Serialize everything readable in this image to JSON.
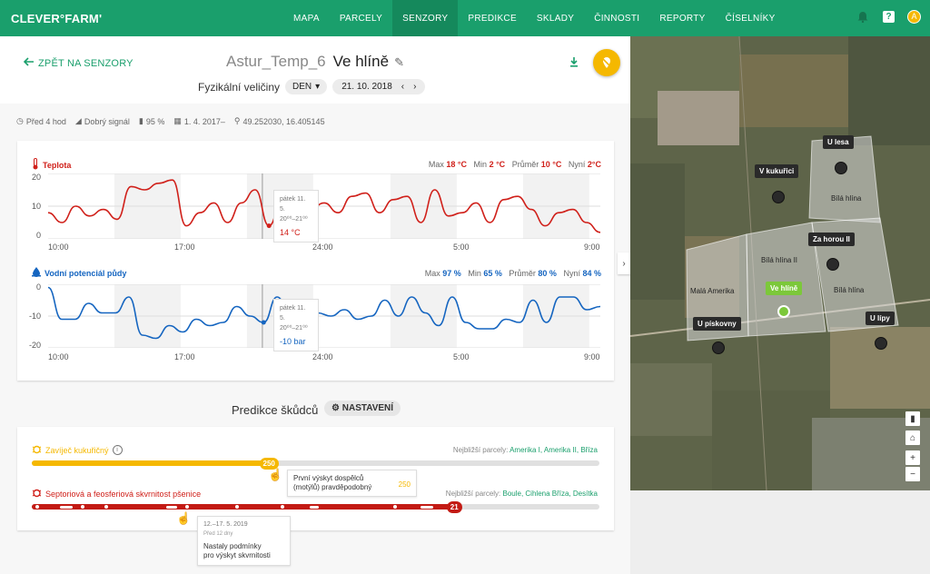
{
  "brand": {
    "logo": "CLEVER°FARM'"
  },
  "nav": {
    "items": [
      "MAPA",
      "PARCELY",
      "SENZORY",
      "PREDIKCE",
      "SKLADY",
      "ČINNOSTI",
      "REPORTY",
      "ČÍSELNÍKY"
    ],
    "active": "SENZORY"
  },
  "topbar": {
    "help": "?",
    "avatar": "A"
  },
  "header": {
    "back": "ZPĚT NA SENZORY",
    "sensor_name": "Astur_Temp_6",
    "location": "Ve hlíně",
    "subtitle": "Fyzikální veličiny",
    "period": "DEN",
    "date": "21. 10. 2018"
  },
  "info": {
    "last_seen": "Před 4 hod",
    "signal": "Dobrý signál",
    "battery": "95 %",
    "since": "1. 4. 2017–",
    "coords": "49.252030, 16.405145"
  },
  "chart_data": [
    {
      "type": "line",
      "title": "Teplota",
      "x_ticks": [
        "10:00",
        "17:00",
        "24:00",
        "5:00",
        "9:00"
      ],
      "y_ticks": [
        "20",
        "10",
        "0"
      ],
      "ylim": [
        0,
        20
      ],
      "stats": {
        "max_label": "Max",
        "max": "18 °C",
        "min_label": "Min",
        "min": "2 °C",
        "avg_label": "Průměr",
        "avg": "10 °C",
        "now_label": "Nyní",
        "now": "2°C"
      },
      "tooltip": {
        "date": "pátek 11. 5.",
        "range": "20⁰⁰–21⁰⁰",
        "value": "14 °C"
      },
      "series": [
        {
          "values": [
            8,
            5,
            10,
            7,
            9,
            6,
            16,
            15,
            17,
            18,
            4,
            8,
            11,
            5,
            11,
            15,
            4,
            13,
            12,
            9,
            11,
            8,
            13,
            14,
            8,
            12,
            13,
            5,
            15,
            7,
            8,
            11,
            5,
            12,
            13,
            9,
            4,
            8,
            9,
            5,
            2
          ]
        }
      ],
      "color": "#d0201a"
    },
    {
      "type": "line",
      "title": "Vodní potenciál půdy",
      "x_ticks": [
        "10:00",
        "17:00",
        "24:00",
        "5:00",
        "9:00"
      ],
      "y_ticks": [
        "0",
        "-10",
        "-20"
      ],
      "ylim": [
        -20,
        0
      ],
      "stats": {
        "max_label": "Max",
        "max": "97 %",
        "min_label": "Min",
        "min": "65 %",
        "avg_label": "Průměr",
        "avg": "80 %",
        "now_label": "Nyní",
        "now": "84 %"
      },
      "tooltip": {
        "date": "pátek 11. 5.",
        "range": "20⁰⁰–21⁰⁰",
        "value": "-10 bar"
      },
      "series": [
        {
          "values": [
            -1,
            -11,
            -11,
            -6,
            -9,
            -9,
            -4,
            -16,
            -17,
            -13,
            -15,
            -11,
            -13,
            -12,
            -7,
            -10,
            -12,
            -4,
            -10,
            -13,
            -9,
            -10,
            -8,
            -11,
            -10,
            -5,
            -10,
            -4,
            -9,
            -13,
            -4,
            -12,
            -14,
            -14,
            -11,
            -12,
            -5,
            -12,
            -4,
            -4,
            -8,
            -7
          ]
        }
      ],
      "color": "#1565c0"
    }
  ],
  "prediction": {
    "title": "Predikce škůdců",
    "settings": "NASTAVENÍ",
    "pests": [
      {
        "name": "Zavíječ kukuřičný",
        "near_label": "Nejbližší parcely:",
        "near": "Amerika I, Amerika II, Bříza",
        "value": "250",
        "progress": 0.42,
        "tip_text1": "První výskyt dospělců",
        "tip_text2": "(motýlů) pravděpodobný",
        "tip_value": "250"
      },
      {
        "name": "Septoriová a feosferiová skvrnitost pšenice",
        "near_label": "Nejbližší parcely:",
        "near": "Boule, Cihlena Bříza, Desítka",
        "value": "21",
        "progress": 0.75,
        "tip_date": "12.–17. 5. 2019",
        "tip_ago": "Před 12 dny",
        "tip_text1": "Nastaly podmínky",
        "tip_text2": "pro výskyt skvrnitosti"
      }
    ]
  },
  "map": {
    "markers": [
      "U lesa",
      "V kukuřici",
      "Za horou II",
      "Ve hlíně",
      "U pískovny",
      "U lípy"
    ],
    "fields": [
      "Bílá hlína",
      "Bílá hlína II",
      "Bílá hlína",
      "Malá Amerika"
    ],
    "controls": {
      "layers": "▮",
      "home": "⌂",
      "plus": "+",
      "minus": "−"
    }
  },
  "colors": {
    "brand": "#1a9f6c",
    "accent": "#f5b800",
    "temp": "#d0201a",
    "water": "#1565c0"
  }
}
